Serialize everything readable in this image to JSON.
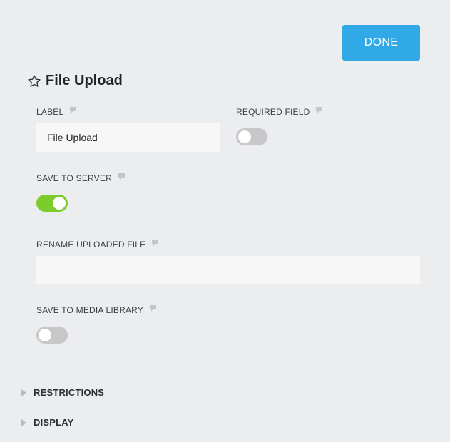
{
  "header": {
    "done_label": "DONE",
    "title": "File Upload",
    "title_icon": "star-outline-icon"
  },
  "fields": {
    "label": {
      "label": "LABEL",
      "value": "File Upload",
      "placeholder": ""
    },
    "required": {
      "label": "REQUIRED FIELD",
      "enabled": false
    },
    "save_to_server": {
      "label": "SAVE TO SERVER",
      "enabled": true
    },
    "rename": {
      "label": "RENAME UPLOADED FILE",
      "value": "",
      "placeholder": ""
    },
    "save_to_media": {
      "label": "SAVE TO MEDIA LIBRARY",
      "enabled": false
    }
  },
  "sections": [
    {
      "label": "RESTRICTIONS",
      "expanded": false
    },
    {
      "label": "DISPLAY",
      "expanded": false
    }
  ],
  "colors": {
    "accent": "#30a9e6",
    "toggle_on": "#7ccd2c",
    "toggle_off": "#c7c7c9",
    "background": "#ecedef"
  },
  "icons": {
    "help": "speech-bubble-icon",
    "section_caret": "caret-right-icon"
  }
}
